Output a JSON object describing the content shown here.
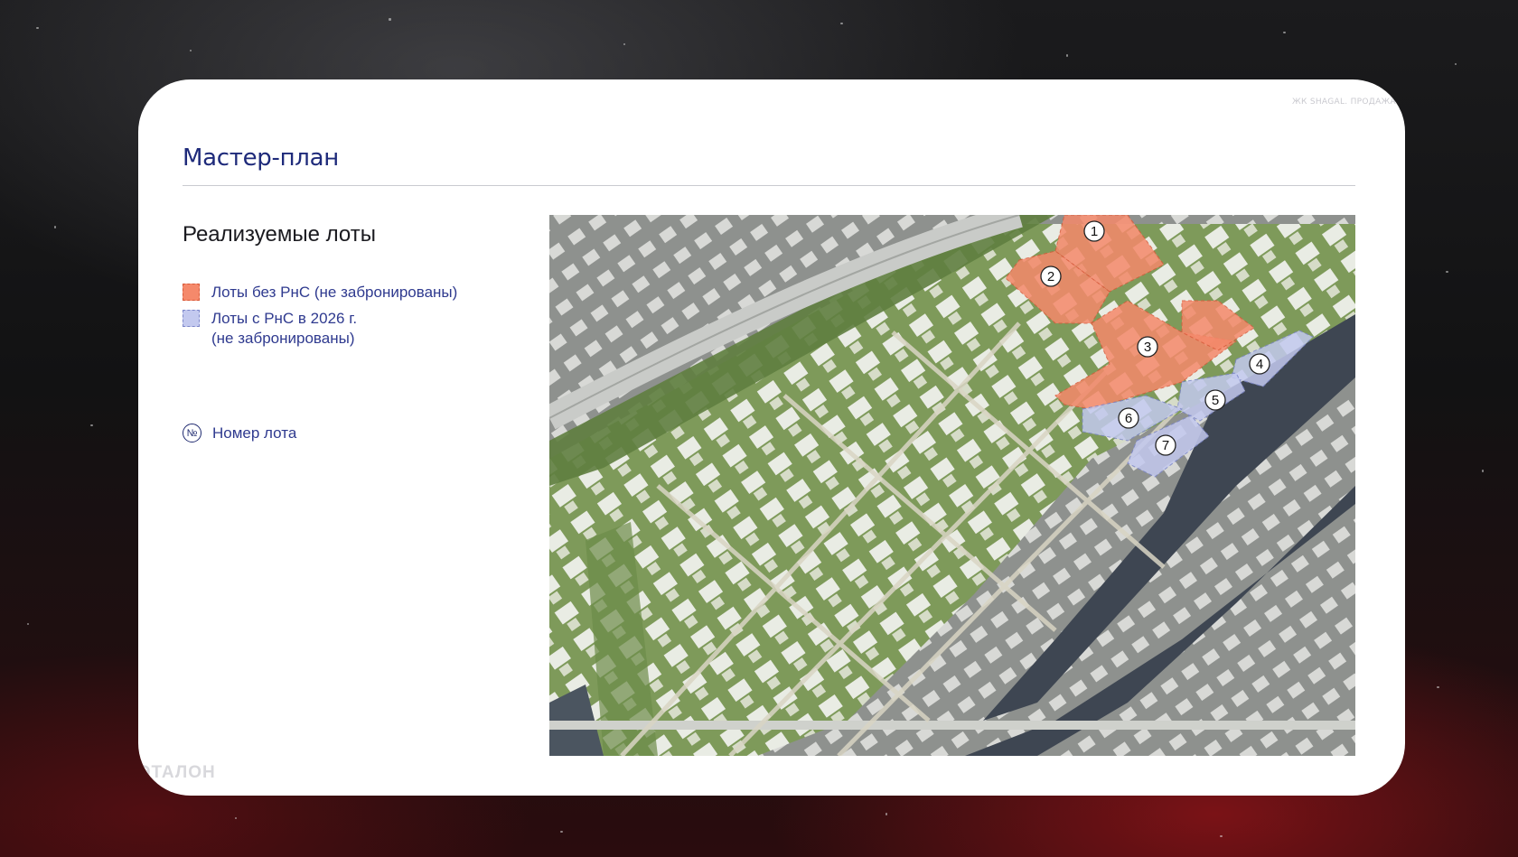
{
  "slide": {
    "top_caption": "ЖК SHAGAL. ПРОДАЖА",
    "title": "Мастер-план",
    "section_title": "Реализуемые лоты",
    "footer_logo": "ЭТАЛОН"
  },
  "legend": {
    "items": [
      {
        "label": "Лоты без РнС (не забронированы)",
        "color": "#f5896b"
      },
      {
        "label": "Лоты с РнС в 2026 г.",
        "label_line2": "(не забронированы)",
        "color": "#c3c9ef"
      }
    ],
    "lot_number": {
      "symbol": "№",
      "label": "Номер лота"
    }
  },
  "map": {
    "lots": [
      {
        "number": "1",
        "status": "orange"
      },
      {
        "number": "2",
        "status": "orange"
      },
      {
        "number": "3",
        "status": "orange"
      },
      {
        "number": "4",
        "status": "blue"
      },
      {
        "number": "5",
        "status": "blue"
      },
      {
        "number": "6",
        "status": "blue"
      },
      {
        "number": "7",
        "status": "blue"
      }
    ]
  },
  "colors": {
    "title": "#1e2a7a",
    "lot_orange": "#f5896b",
    "lot_blue": "#c3c9ef",
    "water": "#3e4652",
    "greenery": "#6f8c4c"
  }
}
